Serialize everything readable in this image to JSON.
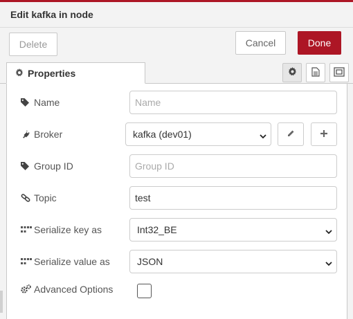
{
  "dialog": {
    "title": "Edit kafka in node"
  },
  "buttons": {
    "delete": "Delete",
    "cancel": "Cancel",
    "done": "Done"
  },
  "tabs": {
    "properties": "Properties"
  },
  "icons": {
    "properties_tab": "gear-icon",
    "settings_tab": "gear-icon",
    "description_tab": "document-icon",
    "appearance_tab": "frame-icon"
  },
  "colors": {
    "accent": "#ad1625",
    "done_text": "#ffffff"
  },
  "form": {
    "name": {
      "label": "Name",
      "placeholder": "Name",
      "value": ""
    },
    "broker": {
      "label": "Broker",
      "value": "kafka (dev01)"
    },
    "group_id": {
      "label": "Group ID",
      "placeholder": "Group ID",
      "value": ""
    },
    "topic": {
      "label": "Topic",
      "value": "test"
    },
    "serialize_key": {
      "label": "Serialize key as",
      "value": "Int32_BE"
    },
    "serialize_value": {
      "label": "Serialize value as",
      "value": "JSON"
    },
    "advanced": {
      "label": "Advanced Options",
      "checked": false
    }
  }
}
